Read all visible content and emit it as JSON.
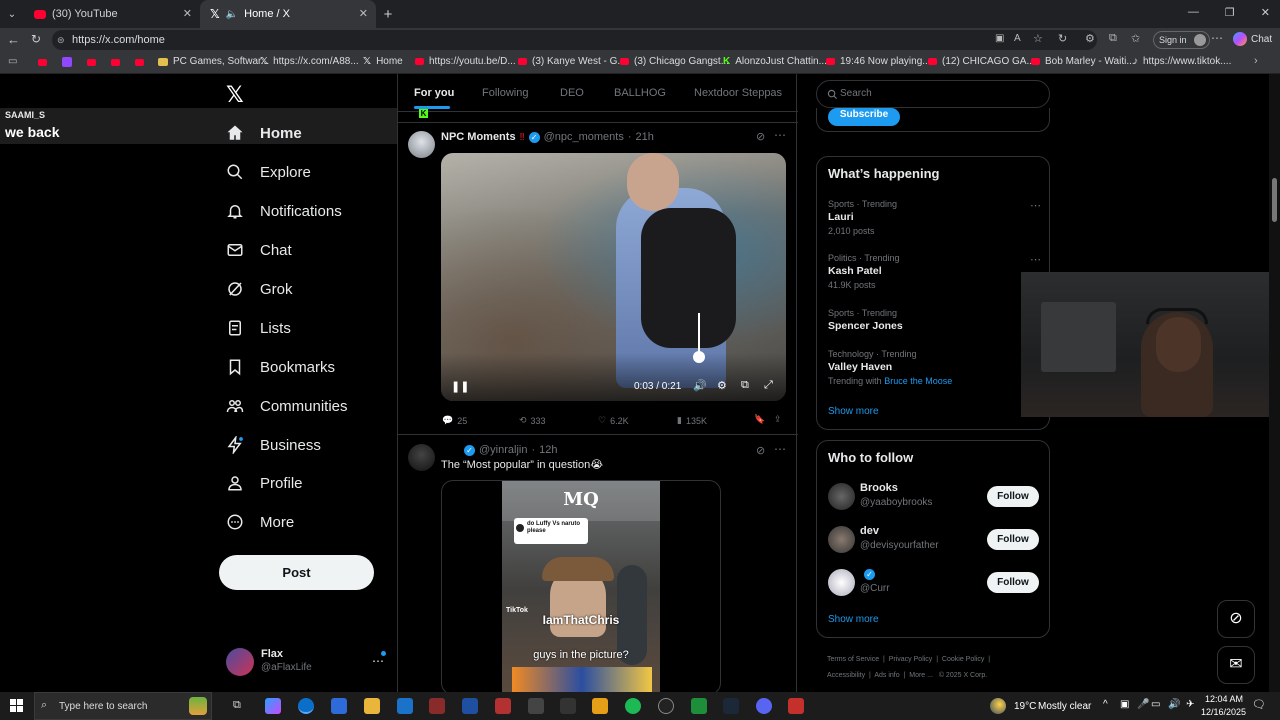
{
  "browser": {
    "tabs": [
      {
        "title": "(30) YouTube"
      },
      {
        "title": "Home / X"
      }
    ],
    "url": "https://x.com/home",
    "bookmarks": [
      "PC Games, Softwar...",
      "https://x.com/A88...",
      "Home",
      "https://youtu.be/D...",
      "(3) Kanye West - G...",
      "(3) Chicago Gangst...",
      "AlonzoJust Chattin...",
      "19:46 Now playing...",
      "(12) CHICAGO GA...",
      "Bob Marley - Waiti...",
      "https://www.tiktok...."
    ],
    "signin_label": "Sign in",
    "chat_label": "Chat"
  },
  "overlay": {
    "username": "SAAMI_S",
    "message": "we back"
  },
  "nav": {
    "items": [
      {
        "label": "Home",
        "icon": "home-icon"
      },
      {
        "label": "Explore",
        "icon": "search-icon"
      },
      {
        "label": "Notifications",
        "icon": "bell-icon"
      },
      {
        "label": "Chat",
        "icon": "mail-icon"
      },
      {
        "label": "Grok",
        "icon": "grok-icon"
      },
      {
        "label": "Lists",
        "icon": "list-icon"
      },
      {
        "label": "Bookmarks",
        "icon": "bookmark-icon"
      },
      {
        "label": "Communities",
        "icon": "people-icon"
      },
      {
        "label": "Business",
        "icon": "lightning-icon"
      },
      {
        "label": "Profile",
        "icon": "person-icon"
      },
      {
        "label": "More",
        "icon": "more-circle-icon"
      }
    ],
    "post_label": "Post",
    "account": {
      "name": "Flax",
      "handle": "@aFlaxLife"
    }
  },
  "feed": {
    "tabs": [
      "For you",
      "Following",
      "DEO",
      "BALLHOG",
      "Nextdoor Steppas"
    ],
    "posts": [
      {
        "author": "NPC Moments",
        "handle": "@npc_moments",
        "time": "21h",
        "video_time": "0:03 / 0:21",
        "replies": "25",
        "reposts": "333",
        "likes": "6.2K",
        "views": "135K"
      },
      {
        "handle": "@yinraljin",
        "time": "12h",
        "text": "The “Most popular” in question😭",
        "image_texts": {
          "brand": "MQ",
          "comment": "do Luffy Vs naruto please",
          "watermark": "IamThatChris",
          "caption": "guys in the picture?",
          "tiktok": "TikTok"
        }
      }
    ]
  },
  "sidebar": {
    "search_placeholder": "Search",
    "subscribe_label": "Subscribe",
    "trending_title": "What’s happening",
    "trends": [
      {
        "category": "Sports · Trending",
        "name": "Lauri",
        "posts": "2,010 posts"
      },
      {
        "category": "Politics · Trending",
        "name": "Kash Patel",
        "posts": "41.9K posts"
      },
      {
        "category": "Sports · Trending",
        "name": "Spencer Jones",
        "posts": ""
      },
      {
        "category": "Technology · Trending",
        "name": "Valley Haven",
        "posts": "Trending with",
        "with": "Bruce the Moose"
      }
    ],
    "show_more": "Show more",
    "who_to_follow_title": "Who to follow",
    "follow_suggestions": [
      {
        "name": "Brooks",
        "handle": "@yaaboybrooks",
        "button": "Follow"
      },
      {
        "name": "dev",
        "handle": "@devisyourfather",
        "button": "Follow"
      },
      {
        "name": "",
        "handle": "@Curr",
        "button": "Follow"
      }
    ],
    "footer_links": [
      "Terms of Service",
      "Privacy Policy",
      "Cookie Policy",
      "Accessibility",
      "Ads info",
      "More ...",
      "© 2025 X Corp."
    ]
  },
  "taskbar": {
    "search_placeholder": "Type here to search",
    "weather": "19°C",
    "weather_desc": "Mostly clear",
    "time": "12:04 AM",
    "date": "12/16/2025"
  }
}
